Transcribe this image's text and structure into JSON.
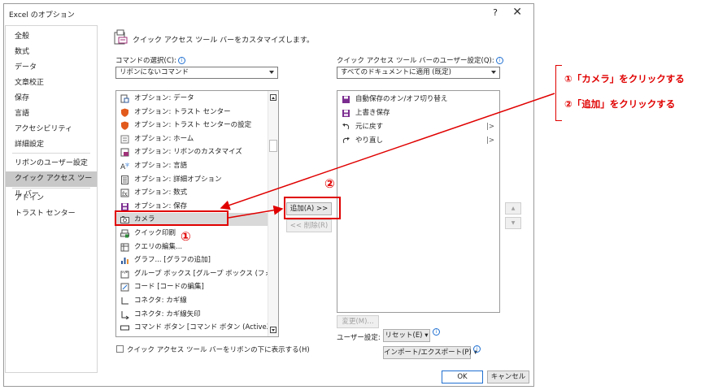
{
  "window": {
    "title": "Excel のオプション",
    "help": "?",
    "close": "✕"
  },
  "nav": {
    "items": [
      {
        "label": "全般"
      },
      {
        "label": "数式"
      },
      {
        "label": "データ"
      },
      {
        "label": "文章校正"
      },
      {
        "label": "保存"
      },
      {
        "label": "言語"
      },
      {
        "label": "アクセシビリティ"
      },
      {
        "label": "詳細設定"
      },
      {
        "label": "リボンのユーザー設定"
      },
      {
        "label": "クイック アクセス ツール バー",
        "selected": true
      },
      {
        "label": "アドイン"
      },
      {
        "label": "トラスト センター"
      }
    ]
  },
  "header": {
    "text": "クイック アクセス ツール バーをカスタマイズします。"
  },
  "commands": {
    "label": "コマンドの選択(C):",
    "selected": "リボンにないコマンド",
    "items": [
      {
        "label": "オプション: データ",
        "icon": "options-data-icon"
      },
      {
        "label": "オプション: トラスト センター",
        "icon": "shield-icon"
      },
      {
        "label": "オプション: トラスト センターの設定",
        "icon": "shield-icon"
      },
      {
        "label": "オプション: ホーム",
        "icon": "options-home-icon"
      },
      {
        "label": "オプション: リボンのカスタマイズ",
        "icon": "ribbon-customize-icon"
      },
      {
        "label": "オプション: 言語",
        "icon": "language-icon"
      },
      {
        "label": "オプション: 詳細オプション",
        "icon": "advanced-options-icon"
      },
      {
        "label": "オプション: 数式",
        "icon": "formula-icon"
      },
      {
        "label": "オプション: 保存",
        "icon": "save-icon"
      },
      {
        "label": "カメラ",
        "icon": "camera-icon",
        "selected": true
      },
      {
        "label": "クイック印刷",
        "icon": "quick-print-icon"
      },
      {
        "label": "クエリの編集...",
        "icon": "query-edit-icon"
      },
      {
        "label": "グラフ... [グラフの追加]",
        "icon": "chart-icon"
      },
      {
        "label": "グループ ボックス [グループ ボックス (フォー...",
        "icon": "group-box-icon"
      },
      {
        "label": "コード [コードの編集]",
        "icon": "code-icon"
      },
      {
        "label": "コネクタ: カギ線",
        "icon": "elbow-connector-icon"
      },
      {
        "label": "コネクタ: カギ線矢印",
        "icon": "elbow-arrow-connector-icon"
      },
      {
        "label": "コマンド ボタン [コマンド ボタン (ActiveX...",
        "icon": "command-button-icon"
      }
    ]
  },
  "qat": {
    "label": "クイック アクセス ツール バーのユーザー設定(Q):",
    "selected": "すべてのドキュメントに適用 (既定)",
    "items": [
      {
        "label": "自動保存のオン/オフ切り替え",
        "icon": "autosave-icon"
      },
      {
        "label": "上書き保存",
        "icon": "save-icon"
      },
      {
        "label": "元に戻す",
        "icon": "undo-icon",
        "submenu": "|>"
      },
      {
        "label": "やり直し",
        "icon": "redo-icon",
        "submenu": "|>"
      }
    ]
  },
  "buttons": {
    "add": "追加(A) >>",
    "remove": "<< 削除(R)",
    "modify": "変更(M)...",
    "user_settings_label": "ユーザー設定:",
    "reset": "リセット(E) ▾",
    "import_export": "インポート/エクスポート(P) ▾",
    "ok": "OK",
    "cancel": "キャンセル",
    "move_up": "▲",
    "move_down": "▼"
  },
  "checkbox": {
    "label": "クイック アクセス ツール バーをリボンの下に表示する(H)",
    "checked": false
  },
  "annotations": {
    "marker1": "①",
    "marker2": "②",
    "step1": "①「カメラ」をクリックする",
    "step2": "②「追加」をクリックする",
    "color": "#e00000"
  }
}
